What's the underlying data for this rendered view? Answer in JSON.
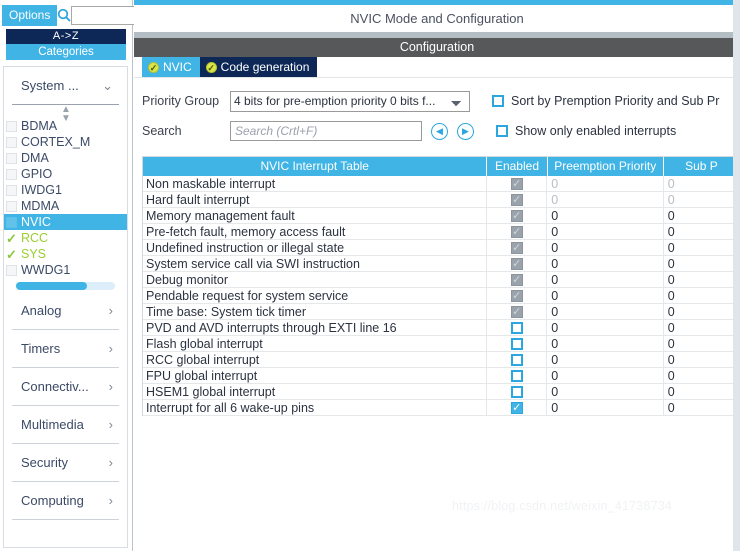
{
  "sidebar": {
    "options_label": "Options",
    "search_icon": "search-icon",
    "search_value": "",
    "az_label": "A->Z",
    "categories_label": "Categories",
    "groups": [
      {
        "label": "System ...",
        "chevron": "chevron-down-icon",
        "open": true
      },
      {
        "label": "Analog",
        "chevron": "chevron-right-icon",
        "open": false
      },
      {
        "label": "Timers",
        "chevron": "chevron-right-icon",
        "open": false
      },
      {
        "label": "Connectiv...",
        "chevron": "chevron-right-icon",
        "open": false
      },
      {
        "label": "Multimedia",
        "chevron": "chevron-right-icon",
        "open": false
      },
      {
        "label": "Security",
        "chevron": "chevron-right-icon",
        "open": false
      },
      {
        "label": "Computing",
        "chevron": "chevron-right-icon",
        "open": false
      }
    ],
    "peripherals": [
      {
        "label": "BDMA",
        "state": "none"
      },
      {
        "label": "CORTEX_M",
        "state": "none"
      },
      {
        "label": "DMA",
        "state": "none"
      },
      {
        "label": "GPIO",
        "state": "none"
      },
      {
        "label": "IWDG1",
        "state": "none"
      },
      {
        "label": "MDMA",
        "state": "none"
      },
      {
        "label": "NVIC",
        "state": "selected"
      },
      {
        "label": "RCC",
        "state": "ok"
      },
      {
        "label": "SYS",
        "state": "ok"
      },
      {
        "label": "WWDG1",
        "state": "none"
      }
    ],
    "scroll_up_icon": "spinner-up-down-icon"
  },
  "header": {
    "title": "NVIC Mode and Configuration",
    "configuration_label": "Configuration"
  },
  "tabs": [
    {
      "label": "NVIC",
      "active": true,
      "status_icon": "check-circle-icon"
    },
    {
      "label": "Code generation",
      "active": false,
      "status_icon": "check-circle-icon"
    }
  ],
  "form": {
    "priority_group_label": "Priority Group",
    "priority_group_value": "4 bits for pre-emption priority 0 bits f...",
    "priority_group_options": [
      "4 bits for pre-emption priority 0 bits f..."
    ],
    "search_label": "Search",
    "search_placeholder": "Search (Crtl+F)",
    "search_value": "",
    "prev_icon": "chevron-left-circle-icon",
    "next_icon": "chevron-right-circle-icon",
    "sort_checkbox_label": "Sort by Premption Priority and Sub Pr",
    "sort_checkbox_checked": false,
    "show_enabled_checkbox_label": "Show only enabled interrupts",
    "show_enabled_checkbox_checked": false
  },
  "table": {
    "columns": [
      "NVIC Interrupt Table",
      "Enabled",
      "Preemption Priority",
      "Sub P"
    ],
    "rows": [
      {
        "name": "Non maskable interrupt",
        "enabled": "locked",
        "preemption": "0",
        "sub": "0",
        "dim": true
      },
      {
        "name": "Hard fault interrupt",
        "enabled": "locked",
        "preemption": "0",
        "sub": "0",
        "dim": true
      },
      {
        "name": "Memory management fault",
        "enabled": "locked",
        "preemption": "0",
        "sub": "0",
        "dim": false
      },
      {
        "name": "Pre-fetch fault, memory access fault",
        "enabled": "locked",
        "preemption": "0",
        "sub": "0",
        "dim": false
      },
      {
        "name": "Undefined instruction or illegal state",
        "enabled": "locked",
        "preemption": "0",
        "sub": "0",
        "dim": false
      },
      {
        "name": "System service call via SWI instruction",
        "enabled": "locked",
        "preemption": "0",
        "sub": "0",
        "dim": false
      },
      {
        "name": "Debug monitor",
        "enabled": "locked",
        "preemption": "0",
        "sub": "0",
        "dim": false
      },
      {
        "name": "Pendable request for system service",
        "enabled": "locked",
        "preemption": "0",
        "sub": "0",
        "dim": false
      },
      {
        "name": "Time base: System tick timer",
        "enabled": "locked",
        "preemption": "0",
        "sub": "0",
        "dim": false
      },
      {
        "name": "PVD and AVD interrupts through EXTI line 16",
        "enabled": "unchecked",
        "preemption": "0",
        "sub": "0",
        "dim": false
      },
      {
        "name": "Flash global interrupt",
        "enabled": "unchecked",
        "preemption": "0",
        "sub": "0",
        "dim": false
      },
      {
        "name": "RCC global interrupt",
        "enabled": "unchecked",
        "preemption": "0",
        "sub": "0",
        "dim": false
      },
      {
        "name": "FPU global interrupt",
        "enabled": "unchecked",
        "preemption": "0",
        "sub": "0",
        "dim": false
      },
      {
        "name": "HSEM1 global interrupt",
        "enabled": "unchecked",
        "preemption": "0",
        "sub": "0",
        "dim": false
      },
      {
        "name": "Interrupt for all 6 wake-up pins",
        "enabled": "checked",
        "preemption": "0",
        "sub": "0",
        "dim": false
      }
    ]
  },
  "watermark": "https://blog.csdn.net/weixin_41738734",
  "colors": {
    "accent": "#3fb4e5",
    "dark_navy": "#0d2857",
    "config_gray": "#56585a",
    "ok_green": "#9acd32"
  }
}
